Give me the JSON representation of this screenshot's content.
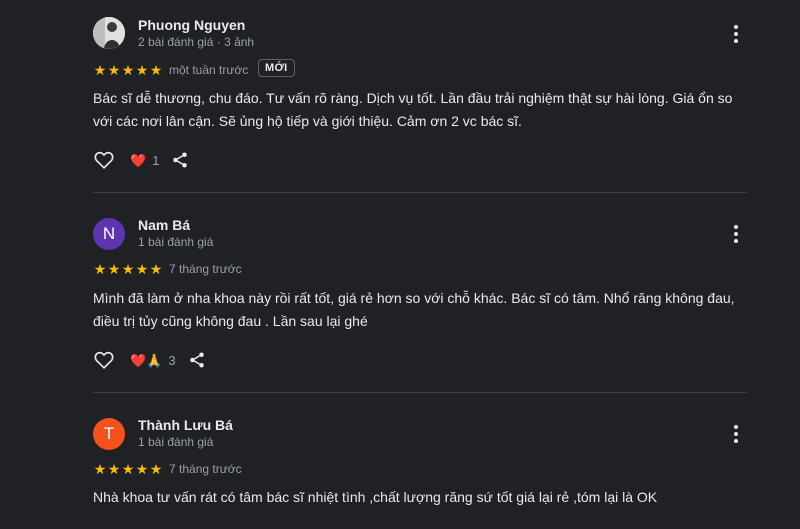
{
  "colors": {
    "background": "#202124",
    "star": "#fbbc04",
    "heart": "#ea4335",
    "avatar_n": "#5e35b1",
    "avatar_t": "#f4511e"
  },
  "reviews": [
    {
      "author": "Phuong Nguyen",
      "meta": "2 bài đánh giá · 3 ảnh",
      "avatar": "photo",
      "rating": 5,
      "time": "một tuần trước",
      "badge": "MỚI",
      "text": "Bác sĩ dễ thương, chu đáo. Tư vấn rõ ràng. Dịch vụ tốt. Lần đầu trải nghiệm thật sự hài lòng. Giá ổn so với các nơi lân cận. Sẽ ủng hộ tiếp và giới thiệu. Cảm ơn 2 vc bác sĩ.",
      "reactions": "❤️",
      "reaction_count": "1"
    },
    {
      "author": "Nam Bá",
      "meta": "1 bài đánh giá",
      "avatar": "N",
      "rating": 5,
      "time": "7 tháng trước",
      "text": "Mình đã làm ở nha khoa này rồi rất tốt, giá rẻ hơn so với chỗ khác. Bác sĩ có tâm. Nhổ răng không đau, điều trị tủy cũng không đau . Lần sau lại ghé",
      "reactions": "❤️🙏",
      "reaction_count": "3"
    },
    {
      "author": "Thành Lưu Bá",
      "meta": "1 bài đánh giá",
      "avatar": "T",
      "rating": 5,
      "time": "7 tháng trước",
      "text": "Nhà khoa tư vấn rát có tâm bác sĩ nhiệt tình ,chất lượng răng sứ tốt giá lại rẻ ,tóm lại là OK"
    }
  ]
}
